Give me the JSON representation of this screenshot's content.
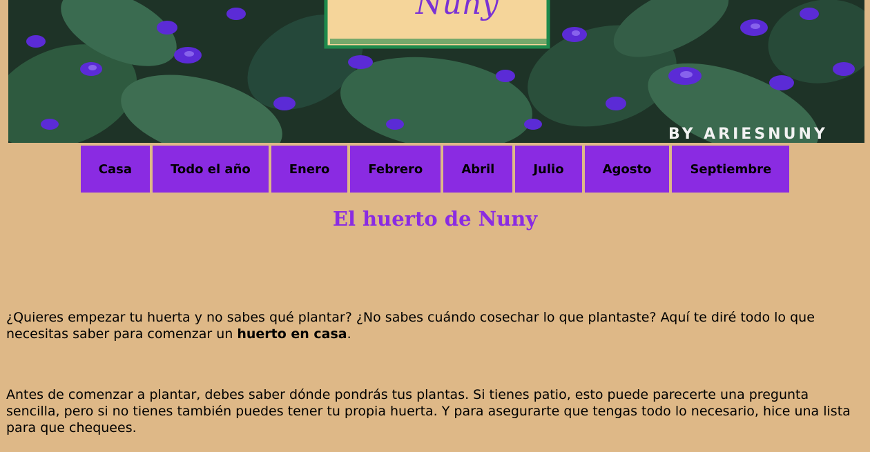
{
  "banner": {
    "brand_script": "Nuny",
    "credit": "BY ARIESNUNY"
  },
  "nav": {
    "items": [
      {
        "label": "Casa"
      },
      {
        "label": "Todo el año"
      },
      {
        "label": "Enero"
      },
      {
        "label": "Febrero"
      },
      {
        "label": "Abril"
      },
      {
        "label": "Julio"
      },
      {
        "label": "Agosto"
      },
      {
        "label": "Septiembre"
      }
    ]
  },
  "main": {
    "title": "El huerto de Nuny",
    "intro": {
      "text_before": "¿Quieres empezar tu huerta y no sabes qué plantar? ¿No sabes cuándo cosechar lo que plantaste? Aquí te diré todo lo que necesitas saber para comenzar un ",
      "bold": "huerto en casa",
      "text_after": "."
    },
    "paragraph2": "Antes de comenzar a plantar, debes saber dónde pondrás tus plantas. Si tienes patio, esto puede parecerte una pregunta sencilla, pero si no tienes también puedes tener tu propia huerta. Y para asegurarte que tengas todo lo necesario, hice una lista para que chequees."
  },
  "colors": {
    "background": "#deb887",
    "accent": "#8a2be2"
  }
}
